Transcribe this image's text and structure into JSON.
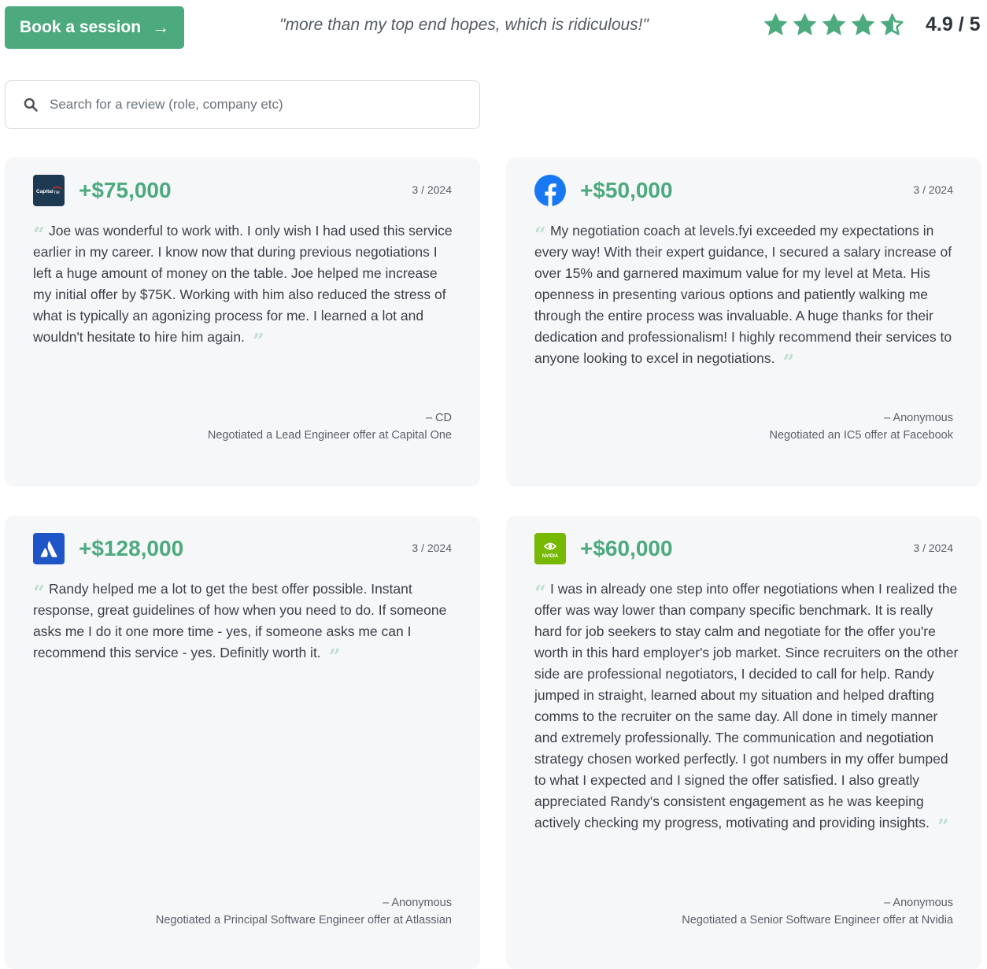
{
  "header": {
    "book_label": "Book a session",
    "tagline": "\"more than my top end hopes, which is ridiculous!\"",
    "rating_text": "4.9 / 5",
    "rating_value": 4.9,
    "rating_max": 5
  },
  "search": {
    "placeholder": "Search for a review (role, company etc)"
  },
  "colors": {
    "accent": "#4caa7e",
    "card_bg": "#f6f7f9",
    "quote_mark": "#bfe0d0"
  },
  "reviews": [
    {
      "logo_icon": "capital-one-logo-icon",
      "amount": "+$75,000",
      "date": "3 / 2024",
      "text": "Joe was wonderful to work with. I only wish I had used this service earlier in my career. I know now that during previous negotiations I left a huge amount of money on the table. Joe helped me increase my initial offer by $75K. Working with him also reduced the stress of what is typically an agonizing process for me. I learned a lot and wouldn't hesitate to hire him again.",
      "author": "– CD",
      "offer": "Negotiated a Lead Engineer offer at Capital One"
    },
    {
      "logo_icon": "facebook-logo-icon",
      "amount": "+$50,000",
      "date": "3 / 2024",
      "text": "My negotiation coach at levels.fyi exceeded my expectations in every way! With their expert guidance, I secured a salary increase of over 15% and garnered maximum value for my level at Meta. His openness in presenting various options and patiently walking me through the entire process was invaluable. A huge thanks for their dedication and professionalism! I highly recommend their services to anyone looking to excel in negotiations.",
      "author": "– Anonymous",
      "offer": "Negotiated an IC5 offer at Facebook"
    },
    {
      "logo_icon": "atlassian-logo-icon",
      "amount": "+$128,000",
      "date": "3 / 2024",
      "text": "Randy helped me a lot to get the best offer possible. Instant response, great guidelines of how when you need to do. If someone asks me I do it one more time - yes, if someone asks me can I recommend this service - yes. Definitly worth it.",
      "author": "– Anonymous",
      "offer": "Negotiated a Principal Software Engineer offer at Atlassian"
    },
    {
      "logo_icon": "nvidia-logo-icon",
      "amount": "+$60,000",
      "date": "3 / 2024",
      "text": "I was in already one step into offer negotiations when I realized the offer was way lower than company specific benchmark. It is really hard for job seekers to stay calm and negotiate for the offer you're worth in this hard employer's job market. Since recruiters on the other side are professional negotiators, I decided to call for help. Randy jumped in straight, learned about my situation and helped drafting comms to the recruiter on the same day. All done in timely manner and extremely professionally. The communication and negotiation strategy chosen worked perfectly. I got numbers in my offer bumped to what I expected and I signed the offer satisfied. I also greatly appreciated Randy's consistent engagement as he was keeping actively checking my progress, motivating and providing insights.",
      "author": "– Anonymous",
      "offer": "Negotiated a Senior Software Engineer offer at Nvidia"
    }
  ]
}
